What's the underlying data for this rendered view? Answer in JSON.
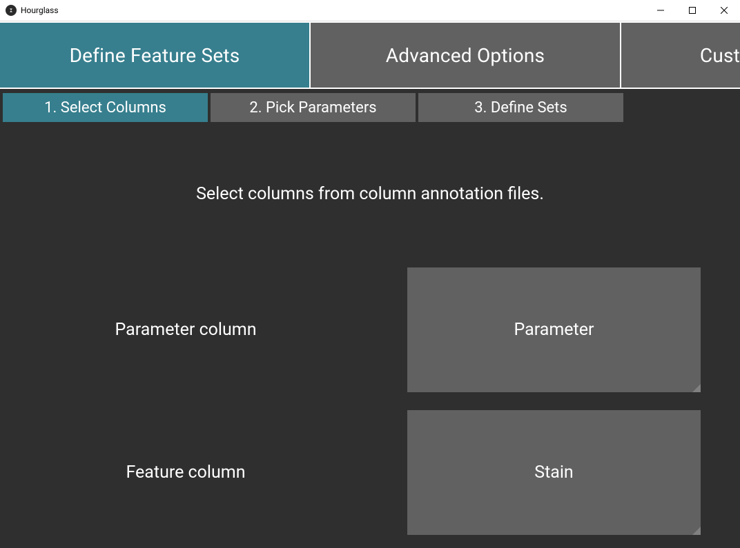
{
  "window": {
    "title": "Hourglass"
  },
  "main_tabs": [
    {
      "label": "Define Feature Sets",
      "active": true
    },
    {
      "label": "Advanced Options",
      "active": false
    },
    {
      "label": "Cust",
      "active": false
    }
  ],
  "sub_tabs": [
    {
      "label": "1. Select Columns",
      "active": true
    },
    {
      "label": "2. Pick Parameters",
      "active": false
    },
    {
      "label": "3. Define Sets",
      "active": false
    }
  ],
  "content": {
    "instruction": "Select columns from column annotation files.",
    "rows": [
      {
        "label": "Parameter column",
        "value": "Parameter"
      },
      {
        "label": "Feature column",
        "value": "Stain"
      }
    ]
  }
}
